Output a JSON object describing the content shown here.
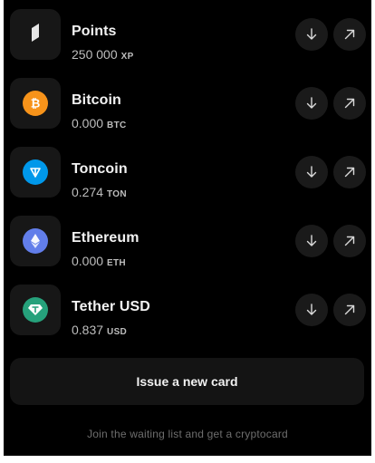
{
  "assets": [
    {
      "name": "Points",
      "amount": "250 000",
      "unit": "XP",
      "icon": "points-icon",
      "color": "#e6e6e6"
    },
    {
      "name": "Bitcoin",
      "amount": "0.000",
      "unit": "BTC",
      "icon": "bitcoin-icon",
      "color": "#f7931a"
    },
    {
      "name": "Toncoin",
      "amount": "0.274",
      "unit": "TON",
      "icon": "toncoin-icon",
      "color": "#0098ea"
    },
    {
      "name": "Ethereum",
      "amount": "0.000",
      "unit": "ETH",
      "icon": "ethereum-icon",
      "color": "#627eea"
    },
    {
      "name": "Tether USD",
      "amount": "0.837",
      "unit": "USD",
      "icon": "tether-icon",
      "color": "#26a17b"
    }
  ],
  "actions": {
    "receive_icon": "arrow-down-icon",
    "send_icon": "arrow-up-right-icon"
  },
  "issue_card": {
    "label": "Issue a new card"
  },
  "footer": {
    "note": "Join the waiting list and get a cryptocard"
  }
}
